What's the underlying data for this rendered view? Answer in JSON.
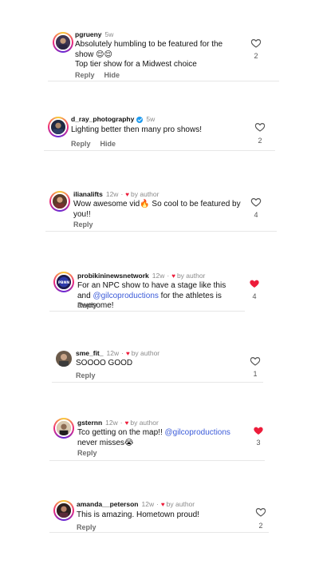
{
  "colors": {
    "like_active": "#ed1c3a",
    "mention": "#3b5bd9",
    "verified": "#1d9bf0"
  },
  "comments": [
    {
      "username": "pgrueny",
      "time": "5w",
      "verified": false,
      "liked_by_author": false,
      "lines": [
        "Absolutely humbling to be featured for the show 😌😌",
        "Top tier show for a Midwest choice"
      ],
      "reply_label": "Reply",
      "hide_label": "Hide",
      "likes": "2",
      "liked": false
    },
    {
      "username": "d_ray_photography",
      "time": "5w",
      "verified": true,
      "liked_by_author": false,
      "lines": [
        "Lighting better then many pro shows!"
      ],
      "reply_label": "Reply",
      "hide_label": "Hide",
      "likes": "2",
      "liked": false
    },
    {
      "username": "ilianalifts",
      "time": "12w",
      "verified": false,
      "liked_by_author": true,
      "by_author_label": "by author",
      "lines": [
        "Wow awesome vid🔥 So cool to be featured by you!!"
      ],
      "reply_label": "Reply",
      "likes": "4",
      "liked": false
    },
    {
      "username": "probikininewsnetwork",
      "time": "12w",
      "verified": false,
      "liked_by_author": true,
      "by_author_label": "by author",
      "text_before": "For an NPC show to have a stage like this and ",
      "mention": "@gilcoproductions",
      "text_after": " for the athletes is awesome!",
      "reply_label": "Reply",
      "likes": "4",
      "liked": true
    },
    {
      "username": "sme_fit_",
      "time": "12w",
      "verified": false,
      "liked_by_author": true,
      "by_author_label": "by author",
      "lines": [
        "SOOOO GOOD"
      ],
      "reply_label": "Reply",
      "likes": "1",
      "liked": false
    },
    {
      "username": "gsternn",
      "time": "12w",
      "verified": false,
      "liked_by_author": true,
      "by_author_label": "by author",
      "text_before": "Tco getting on the map!! ",
      "mention": "@gilcoproductions",
      "text_after": " never misses😭",
      "reply_label": "Reply",
      "likes": "3",
      "liked": true
    },
    {
      "username": "amanda__peterson",
      "time": "12w",
      "verified": false,
      "liked_by_author": true,
      "by_author_label": "by author",
      "lines": [
        "This is amazing. Hometown proud!"
      ],
      "reply_label": "Reply",
      "likes": "2",
      "liked": false
    }
  ]
}
